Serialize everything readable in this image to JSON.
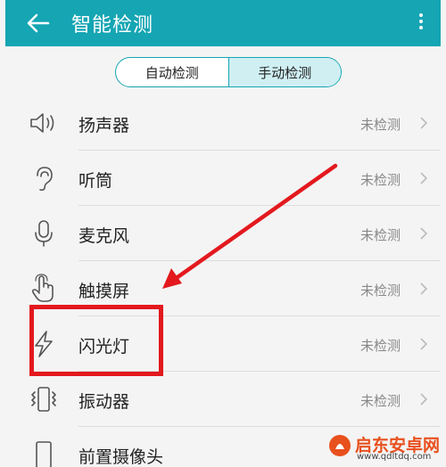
{
  "header": {
    "title": "智能检测"
  },
  "tabs": [
    {
      "label": "自动检测",
      "active": false
    },
    {
      "label": "手动检测",
      "active": true
    }
  ],
  "items": [
    {
      "label": "扬声器",
      "status": "未检测",
      "icon": "speaker-icon"
    },
    {
      "label": "听筒",
      "status": "未检测",
      "icon": "ear-icon"
    },
    {
      "label": "麦克风",
      "status": "未检测",
      "icon": "microphone-icon"
    },
    {
      "label": "触摸屏",
      "status": "未检测",
      "icon": "touch-icon"
    },
    {
      "label": "闪光灯",
      "status": "未检测",
      "icon": "flash-icon"
    },
    {
      "label": "振动器",
      "status": "未检测",
      "icon": "vibration-icon"
    },
    {
      "label": "前置摄像头",
      "status": "",
      "icon": "phone-icon"
    }
  ],
  "watermark": {
    "title": "启东安卓网",
    "url": "www.qdltdq.com"
  },
  "colors": {
    "accent": "#15a5b3",
    "annotation": "#e3191e",
    "watermark": "#e8501d"
  }
}
